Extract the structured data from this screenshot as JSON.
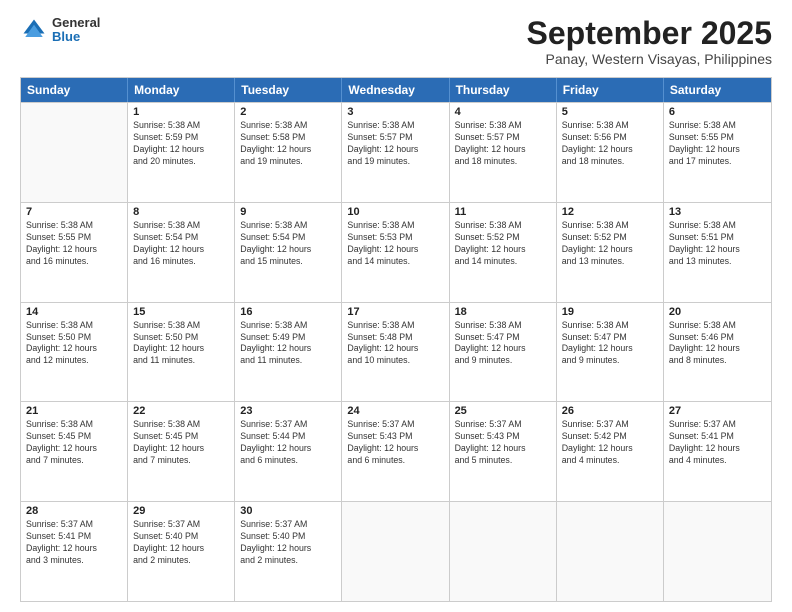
{
  "logo": {
    "general": "General",
    "blue": "Blue"
  },
  "title": "September 2025",
  "subtitle": "Panay, Western Visayas, Philippines",
  "headers": [
    "Sunday",
    "Monday",
    "Tuesday",
    "Wednesday",
    "Thursday",
    "Friday",
    "Saturday"
  ],
  "rows": [
    [
      {
        "day": "",
        "info": ""
      },
      {
        "day": "1",
        "info": "Sunrise: 5:38 AM\nSunset: 5:59 PM\nDaylight: 12 hours\nand 20 minutes."
      },
      {
        "day": "2",
        "info": "Sunrise: 5:38 AM\nSunset: 5:58 PM\nDaylight: 12 hours\nand 19 minutes."
      },
      {
        "day": "3",
        "info": "Sunrise: 5:38 AM\nSunset: 5:57 PM\nDaylight: 12 hours\nand 19 minutes."
      },
      {
        "day": "4",
        "info": "Sunrise: 5:38 AM\nSunset: 5:57 PM\nDaylight: 12 hours\nand 18 minutes."
      },
      {
        "day": "5",
        "info": "Sunrise: 5:38 AM\nSunset: 5:56 PM\nDaylight: 12 hours\nand 18 minutes."
      },
      {
        "day": "6",
        "info": "Sunrise: 5:38 AM\nSunset: 5:55 PM\nDaylight: 12 hours\nand 17 minutes."
      }
    ],
    [
      {
        "day": "7",
        "info": "Sunrise: 5:38 AM\nSunset: 5:55 PM\nDaylight: 12 hours\nand 16 minutes."
      },
      {
        "day": "8",
        "info": "Sunrise: 5:38 AM\nSunset: 5:54 PM\nDaylight: 12 hours\nand 16 minutes."
      },
      {
        "day": "9",
        "info": "Sunrise: 5:38 AM\nSunset: 5:54 PM\nDaylight: 12 hours\nand 15 minutes."
      },
      {
        "day": "10",
        "info": "Sunrise: 5:38 AM\nSunset: 5:53 PM\nDaylight: 12 hours\nand 14 minutes."
      },
      {
        "day": "11",
        "info": "Sunrise: 5:38 AM\nSunset: 5:52 PM\nDaylight: 12 hours\nand 14 minutes."
      },
      {
        "day": "12",
        "info": "Sunrise: 5:38 AM\nSunset: 5:52 PM\nDaylight: 12 hours\nand 13 minutes."
      },
      {
        "day": "13",
        "info": "Sunrise: 5:38 AM\nSunset: 5:51 PM\nDaylight: 12 hours\nand 13 minutes."
      }
    ],
    [
      {
        "day": "14",
        "info": "Sunrise: 5:38 AM\nSunset: 5:50 PM\nDaylight: 12 hours\nand 12 minutes."
      },
      {
        "day": "15",
        "info": "Sunrise: 5:38 AM\nSunset: 5:50 PM\nDaylight: 12 hours\nand 11 minutes."
      },
      {
        "day": "16",
        "info": "Sunrise: 5:38 AM\nSunset: 5:49 PM\nDaylight: 12 hours\nand 11 minutes."
      },
      {
        "day": "17",
        "info": "Sunrise: 5:38 AM\nSunset: 5:48 PM\nDaylight: 12 hours\nand 10 minutes."
      },
      {
        "day": "18",
        "info": "Sunrise: 5:38 AM\nSunset: 5:47 PM\nDaylight: 12 hours\nand 9 minutes."
      },
      {
        "day": "19",
        "info": "Sunrise: 5:38 AM\nSunset: 5:47 PM\nDaylight: 12 hours\nand 9 minutes."
      },
      {
        "day": "20",
        "info": "Sunrise: 5:38 AM\nSunset: 5:46 PM\nDaylight: 12 hours\nand 8 minutes."
      }
    ],
    [
      {
        "day": "21",
        "info": "Sunrise: 5:38 AM\nSunset: 5:45 PM\nDaylight: 12 hours\nand 7 minutes."
      },
      {
        "day": "22",
        "info": "Sunrise: 5:38 AM\nSunset: 5:45 PM\nDaylight: 12 hours\nand 7 minutes."
      },
      {
        "day": "23",
        "info": "Sunrise: 5:37 AM\nSunset: 5:44 PM\nDaylight: 12 hours\nand 6 minutes."
      },
      {
        "day": "24",
        "info": "Sunrise: 5:37 AM\nSunset: 5:43 PM\nDaylight: 12 hours\nand 6 minutes."
      },
      {
        "day": "25",
        "info": "Sunrise: 5:37 AM\nSunset: 5:43 PM\nDaylight: 12 hours\nand 5 minutes."
      },
      {
        "day": "26",
        "info": "Sunrise: 5:37 AM\nSunset: 5:42 PM\nDaylight: 12 hours\nand 4 minutes."
      },
      {
        "day": "27",
        "info": "Sunrise: 5:37 AM\nSunset: 5:41 PM\nDaylight: 12 hours\nand 4 minutes."
      }
    ],
    [
      {
        "day": "28",
        "info": "Sunrise: 5:37 AM\nSunset: 5:41 PM\nDaylight: 12 hours\nand 3 minutes."
      },
      {
        "day": "29",
        "info": "Sunrise: 5:37 AM\nSunset: 5:40 PM\nDaylight: 12 hours\nand 2 minutes."
      },
      {
        "day": "30",
        "info": "Sunrise: 5:37 AM\nSunset: 5:40 PM\nDaylight: 12 hours\nand 2 minutes."
      },
      {
        "day": "",
        "info": ""
      },
      {
        "day": "",
        "info": ""
      },
      {
        "day": "",
        "info": ""
      },
      {
        "day": "",
        "info": ""
      }
    ]
  ]
}
